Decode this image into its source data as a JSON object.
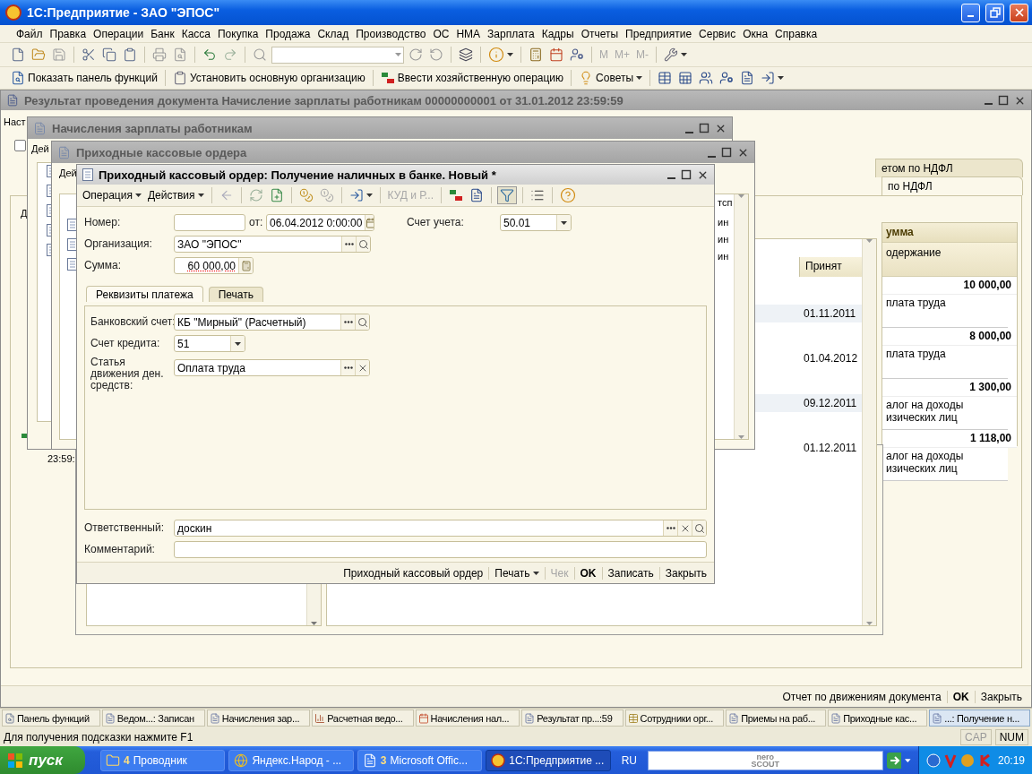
{
  "app_window": {
    "title": "1С:Предприятие - ЗАО \"ЭПОС\""
  },
  "menu": [
    "Файл",
    "Правка",
    "Операции",
    "Банк",
    "Касса",
    "Покупка",
    "Продажа",
    "Склад",
    "Производство",
    "ОС",
    "НМА",
    "Зарплата",
    "Кадры",
    "Отчеты",
    "Предприятие",
    "Сервис",
    "Окна",
    "Справка"
  ],
  "toolbar_memory": [
    {
      "label": "M",
      "disabled": true
    },
    {
      "label": "M+",
      "disabled": true
    },
    {
      "label": "M-",
      "disabled": true
    }
  ],
  "toolbar_commands": [
    "Показать панель функций",
    "Установить основную организацию",
    "Ввести хозяйственную операцию",
    "Советы"
  ],
  "result_window": {
    "title": "Результат проведения документа Начисление зарплаты работникам 00000000001 от 31.01.2012 23:59:59",
    "settings_fragment": "Наст",
    "filter_checkbox": {
      "checked": false
    },
    "tabs": [
      {
        "label": "етом по НДФЛ",
        "selected": false
      },
      {
        "label": "по НДФЛ",
        "selected": true
      }
    ],
    "list_fragment": "Д",
    "time_fragment": "23:59:",
    "register_columns": [
      "Принят"
    ],
    "register_rows": [
      "01.11.2011",
      "01.04.2012",
      "09.12.2011",
      "01.12.2011"
    ],
    "amount_columns": [
      "умма",
      "одержание"
    ],
    "amount_rows": [
      {
        "amount": "10 000,00",
        "text": "плата труда"
      },
      {
        "amount": "8 000,00",
        "text": "плата труда"
      },
      {
        "amount": "1 300,00",
        "text": "алог на доходы изических лиц"
      },
      {
        "amount": "1 118,00",
        "text": "алог на доходы изических лиц"
      }
    ],
    "footer": [
      {
        "label": "Отчет по движениям документа",
        "default": false
      },
      {
        "label": "OK",
        "default": true
      },
      {
        "label": "Закрыть",
        "default": false
      }
    ]
  },
  "accruals_window": {
    "title": "Начисления зарплаты работникам",
    "toolbar_fragment": "Дей"
  },
  "orders_window": {
    "title": "Приходные кассовые ордера",
    "toolbar_fragment": "Дей",
    "column_fragment": "тсп",
    "rows": [
      "ин",
      "ин",
      "ин"
    ]
  },
  "dialog": {
    "title": "Приходный кассовый ордер: Получение наличных в банке. Новый *",
    "menus": [
      "Операция",
      "Действия"
    ],
    "kud_button": {
      "label": "КУД и Р...",
      "disabled": true
    },
    "structure_toggle": {
      "pressed": true
    },
    "number": {
      "label": "Номер:"
    },
    "date": {
      "label": "от:",
      "value": "06.04.2012  0:00:00"
    },
    "account": {
      "label": "Счет учета:",
      "value": "50.01"
    },
    "organization": {
      "label": "Организация:",
      "value": "ЗАО \"ЭПОС\""
    },
    "sum": {
      "label": "Сумма:",
      "value": "60 000,00"
    },
    "tabs": [
      {
        "label": "Реквизиты платежа",
        "selected": true
      },
      {
        "label": "Печать",
        "selected": false
      }
    ],
    "bank_account": {
      "label": "Банковский счет:",
      "value": "КБ \"Мирный\" (Расчетный)"
    },
    "credit_account": {
      "label": "Счет кредита:",
      "value": "51"
    },
    "cash_flow_item": {
      "label": "Статья движения ден. средств:",
      "value": "Оплата труда"
    },
    "responsible": {
      "label": "Ответственный:",
      "value": "доскин"
    },
    "comment": {
      "label": "Комментарий:"
    },
    "footer": [
      {
        "label": "Приходный кассовый ордер",
        "kind": "button",
        "disabled": false
      },
      {
        "label": "Печать",
        "kind": "menu",
        "disabled": false
      },
      {
        "label": "Чек",
        "kind": "button",
        "disabled": true
      },
      {
        "label": "OK",
        "kind": "default",
        "disabled": false
      },
      {
        "label": "Записать",
        "kind": "button",
        "disabled": false
      },
      {
        "label": "Закрыть",
        "kind": "button",
        "disabled": false
      }
    ]
  },
  "window_bar": [
    {
      "label": "Панель функций",
      "kind": "panel",
      "selected": false
    },
    {
      "label": "Ведом...: Записан",
      "kind": "document",
      "selected": false
    },
    {
      "label": "Начисления зар...",
      "kind": "document",
      "selected": false
    },
    {
      "label": "Расчетная ведо...",
      "kind": "report",
      "selected": false
    },
    {
      "label": "Начисления нал...",
      "kind": "calendar",
      "selected": false
    },
    {
      "label": "Результат пр...:59",
      "kind": "result",
      "selected": false
    },
    {
      "label": "Сотрудники орг...",
      "kind": "list",
      "selected": false
    },
    {
      "label": "Приемы на раб...",
      "kind": "document",
      "selected": false
    },
    {
      "label": "Приходные кас...",
      "kind": "document",
      "selected": false
    },
    {
      "label": "...: Получение н...",
      "kind": "document",
      "selected": true
    }
  ],
  "status_bar": {
    "hint": "Для получения подсказки нажмите F1",
    "indicators": [
      {
        "label": "CAP",
        "on": false
      },
      {
        "label": "NUM",
        "on": true
      }
    ]
  },
  "taskbar": {
    "start": "пуск",
    "tasks": [
      {
        "count": "4",
        "label": "Проводник",
        "kind": "folder",
        "selected": false
      },
      {
        "label": "Яндекс.Народ - ...",
        "kind": "browser",
        "selected": false
      },
      {
        "count": "3",
        "label": "Microsoft Offic...",
        "kind": "word",
        "selected": false
      },
      {
        "label": "1С:Предприятие ...",
        "kind": "app",
        "selected": true
      }
    ],
    "language": "RU",
    "search_logo": [
      "nero",
      "SCOUT"
    ],
    "clock": "20:19"
  }
}
